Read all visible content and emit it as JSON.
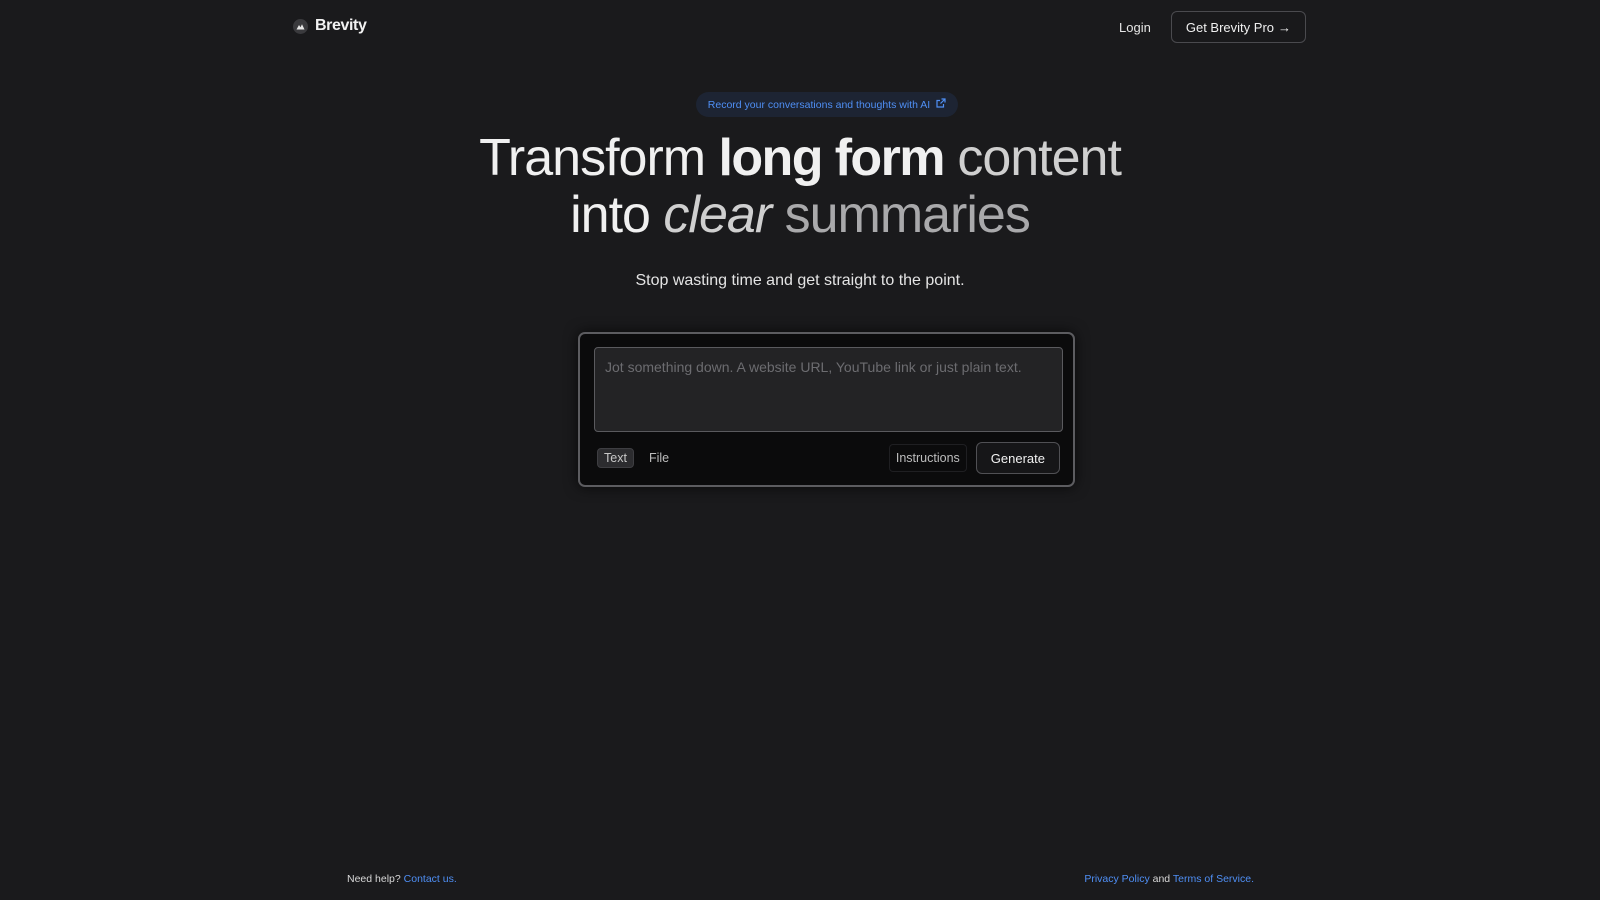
{
  "header": {
    "brand_name": "Brevity",
    "login_label": "Login",
    "pro_button_label": "Get Brevity Pro",
    "pro_button_arrow": "→"
  },
  "announcement": {
    "text": "Record your conversations and thoughts with AI",
    "icon": "external-link-icon"
  },
  "hero": {
    "line1_part1": "Transform ",
    "line1_bold": "long form",
    "line1_part2": " content",
    "line2_part1": "into ",
    "line2_italic": "clear",
    "line2_part2": " summaries",
    "subtitle": "Stop wasting time and get straight to the point."
  },
  "input_card": {
    "placeholder": "Jot something down. A website URL, YouTube link or just plain text.",
    "value": "",
    "tabs": [
      {
        "label": "Text",
        "active": true
      },
      {
        "label": "File",
        "active": false
      }
    ],
    "instructions_label": "Instructions",
    "generate_label": "Generate"
  },
  "footer": {
    "help_text": "Need help?",
    "contact_link": "Contact us",
    "contact_suffix": ".",
    "privacy_link": "Privacy Policy",
    "and_text": "and",
    "terms_link": "Terms of Service",
    "terms_suffix": "."
  },
  "colors": {
    "background": "#1a1a1c",
    "accent_link": "#4f8ff5",
    "pill_background": "#1d2433"
  }
}
